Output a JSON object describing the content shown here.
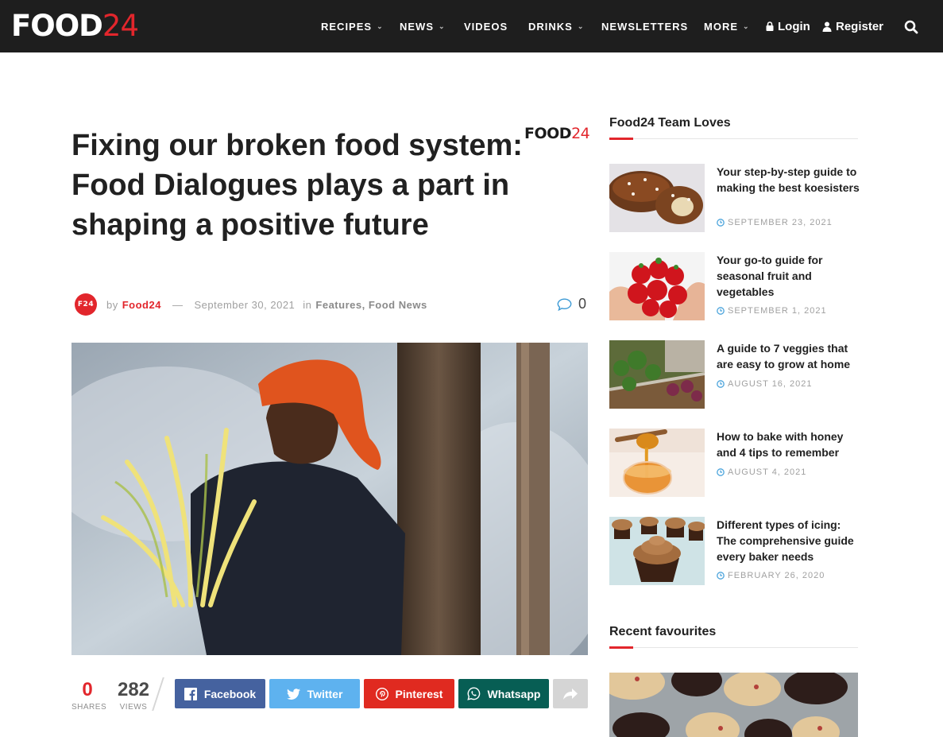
{
  "brand": {
    "logo_white": "FOOD",
    "logo_red": "24"
  },
  "nav": {
    "items": [
      "RECIPES",
      "NEWS",
      "VIDEOS",
      "DRINKS",
      "NEWSLETTERS",
      "MORE"
    ],
    "login": "Login",
    "register": "Register"
  },
  "article": {
    "title": "Fixing our broken food system: Food Dialogues plays a part in shaping a positive future",
    "badge_black": "FOOD",
    "badge_red": "24",
    "avatar_text": "F24",
    "by": "by",
    "author": "Food24",
    "dash": "—",
    "date": "September 30, 2021",
    "in": "in",
    "categories": [
      "Features",
      "Food News"
    ],
    "comma": ",",
    "comment_count": "0"
  },
  "share": {
    "shares_count": "0",
    "shares_label": "SHARES",
    "views_count": "282",
    "views_label": "VIEWS",
    "facebook": "Facebook",
    "twitter": "Twitter",
    "pinterest": "Pinterest",
    "whatsapp": "Whatsapp"
  },
  "sidebar": {
    "team_loves_title": "Food24 Team Loves",
    "posts": [
      {
        "title": "Your step-by-step guide to making the best koesisters",
        "date": "SEPTEMBER 23, 2021"
      },
      {
        "title": "Your go-to guide for seasonal fruit and vegetables",
        "date": "SEPTEMBER 1, 2021"
      },
      {
        "title": "A guide to 7 veggies that are easy to grow at home",
        "date": "AUGUST 16, 2021"
      },
      {
        "title": "How to bake with honey and 4 tips to remember",
        "date": "AUGUST 4, 2021"
      },
      {
        "title": "Different types of icing: The comprehensive guide every baker needs",
        "date": "FEBRUARY 26, 2020"
      }
    ],
    "recent_title": "Recent favourites"
  },
  "colors": {
    "accent": "#e2262c",
    "topbar": "#1e1e1e",
    "facebook": "#45629f",
    "twitter": "#5eb2ef",
    "pinterest": "#e02a20",
    "whatsapp": "#075e54",
    "more_share": "#d5d5d5",
    "date_icon": "#4ba4dc"
  },
  "icons": [
    "lock-icon",
    "user-icon",
    "search-icon",
    "comment-icon",
    "facebook-icon",
    "twitter-icon",
    "pinterest-icon",
    "whatsapp-icon",
    "share-arrow-icon",
    "clock-icon"
  ]
}
